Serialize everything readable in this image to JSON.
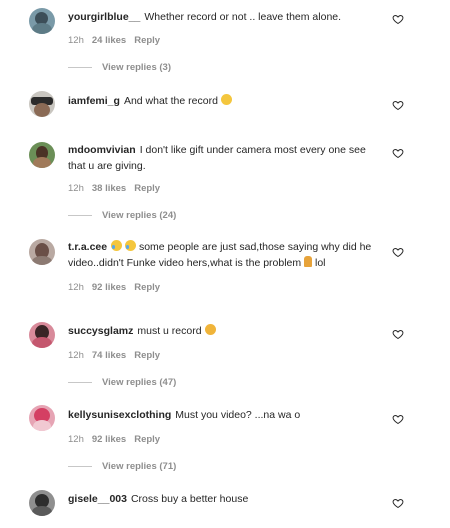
{
  "colors": {
    "text": "#262626",
    "secondary": "#8e8e8e",
    "divider": "#c7c7c7"
  },
  "comments": [
    {
      "username": "yourgirlblue__",
      "text": "Whether record or not .. leave them alone.",
      "time": "12h",
      "likes": "24 likes",
      "reply": "Reply",
      "view_replies": "View replies (3)"
    },
    {
      "username": "iamfemi_g",
      "text": "And what the record",
      "emoji_after": "smiling-face-emoji"
    },
    {
      "username": "mdoomvivian",
      "text": "I don't like gift under camera most every one see that u are giving.",
      "time": "12h",
      "likes": "38 likes",
      "reply": "Reply",
      "view_replies": "View replies (24)"
    },
    {
      "username": "t.r.a.cee",
      "text_start": "some people are just sad,those saying why did he video..didn't Funke video hers,what is the problem",
      "text_end": "lol",
      "time": "12h",
      "likes": "92 likes",
      "reply": "Reply"
    },
    {
      "username": "succysglamz",
      "text": "must u record",
      "time": "12h",
      "likes": "74 likes",
      "reply": "Reply",
      "view_replies": "View replies (47)"
    },
    {
      "username": "kellysunisexclothing",
      "text": "Must you video? ...na wa o",
      "time": "12h",
      "likes": "92 likes",
      "reply": "Reply",
      "view_replies": "View replies (71)"
    },
    {
      "username": "gisele__003",
      "text": "Cross buy a better house"
    }
  ]
}
